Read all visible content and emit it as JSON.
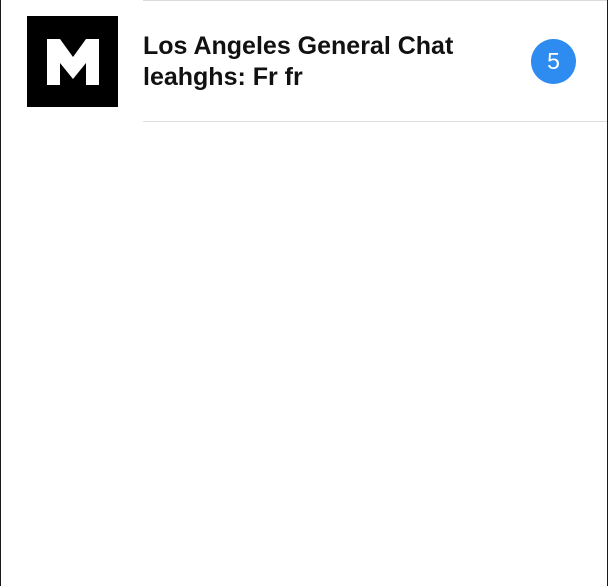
{
  "chat_list": {
    "items": [
      {
        "avatar_icon": "m-logo-icon",
        "avatar_letter": "M",
        "title": "Los Angeles General Chat",
        "preview": "leahghs: Fr fr",
        "unread_count": "5",
        "badge_color": "#2e8bf0"
      }
    ]
  }
}
